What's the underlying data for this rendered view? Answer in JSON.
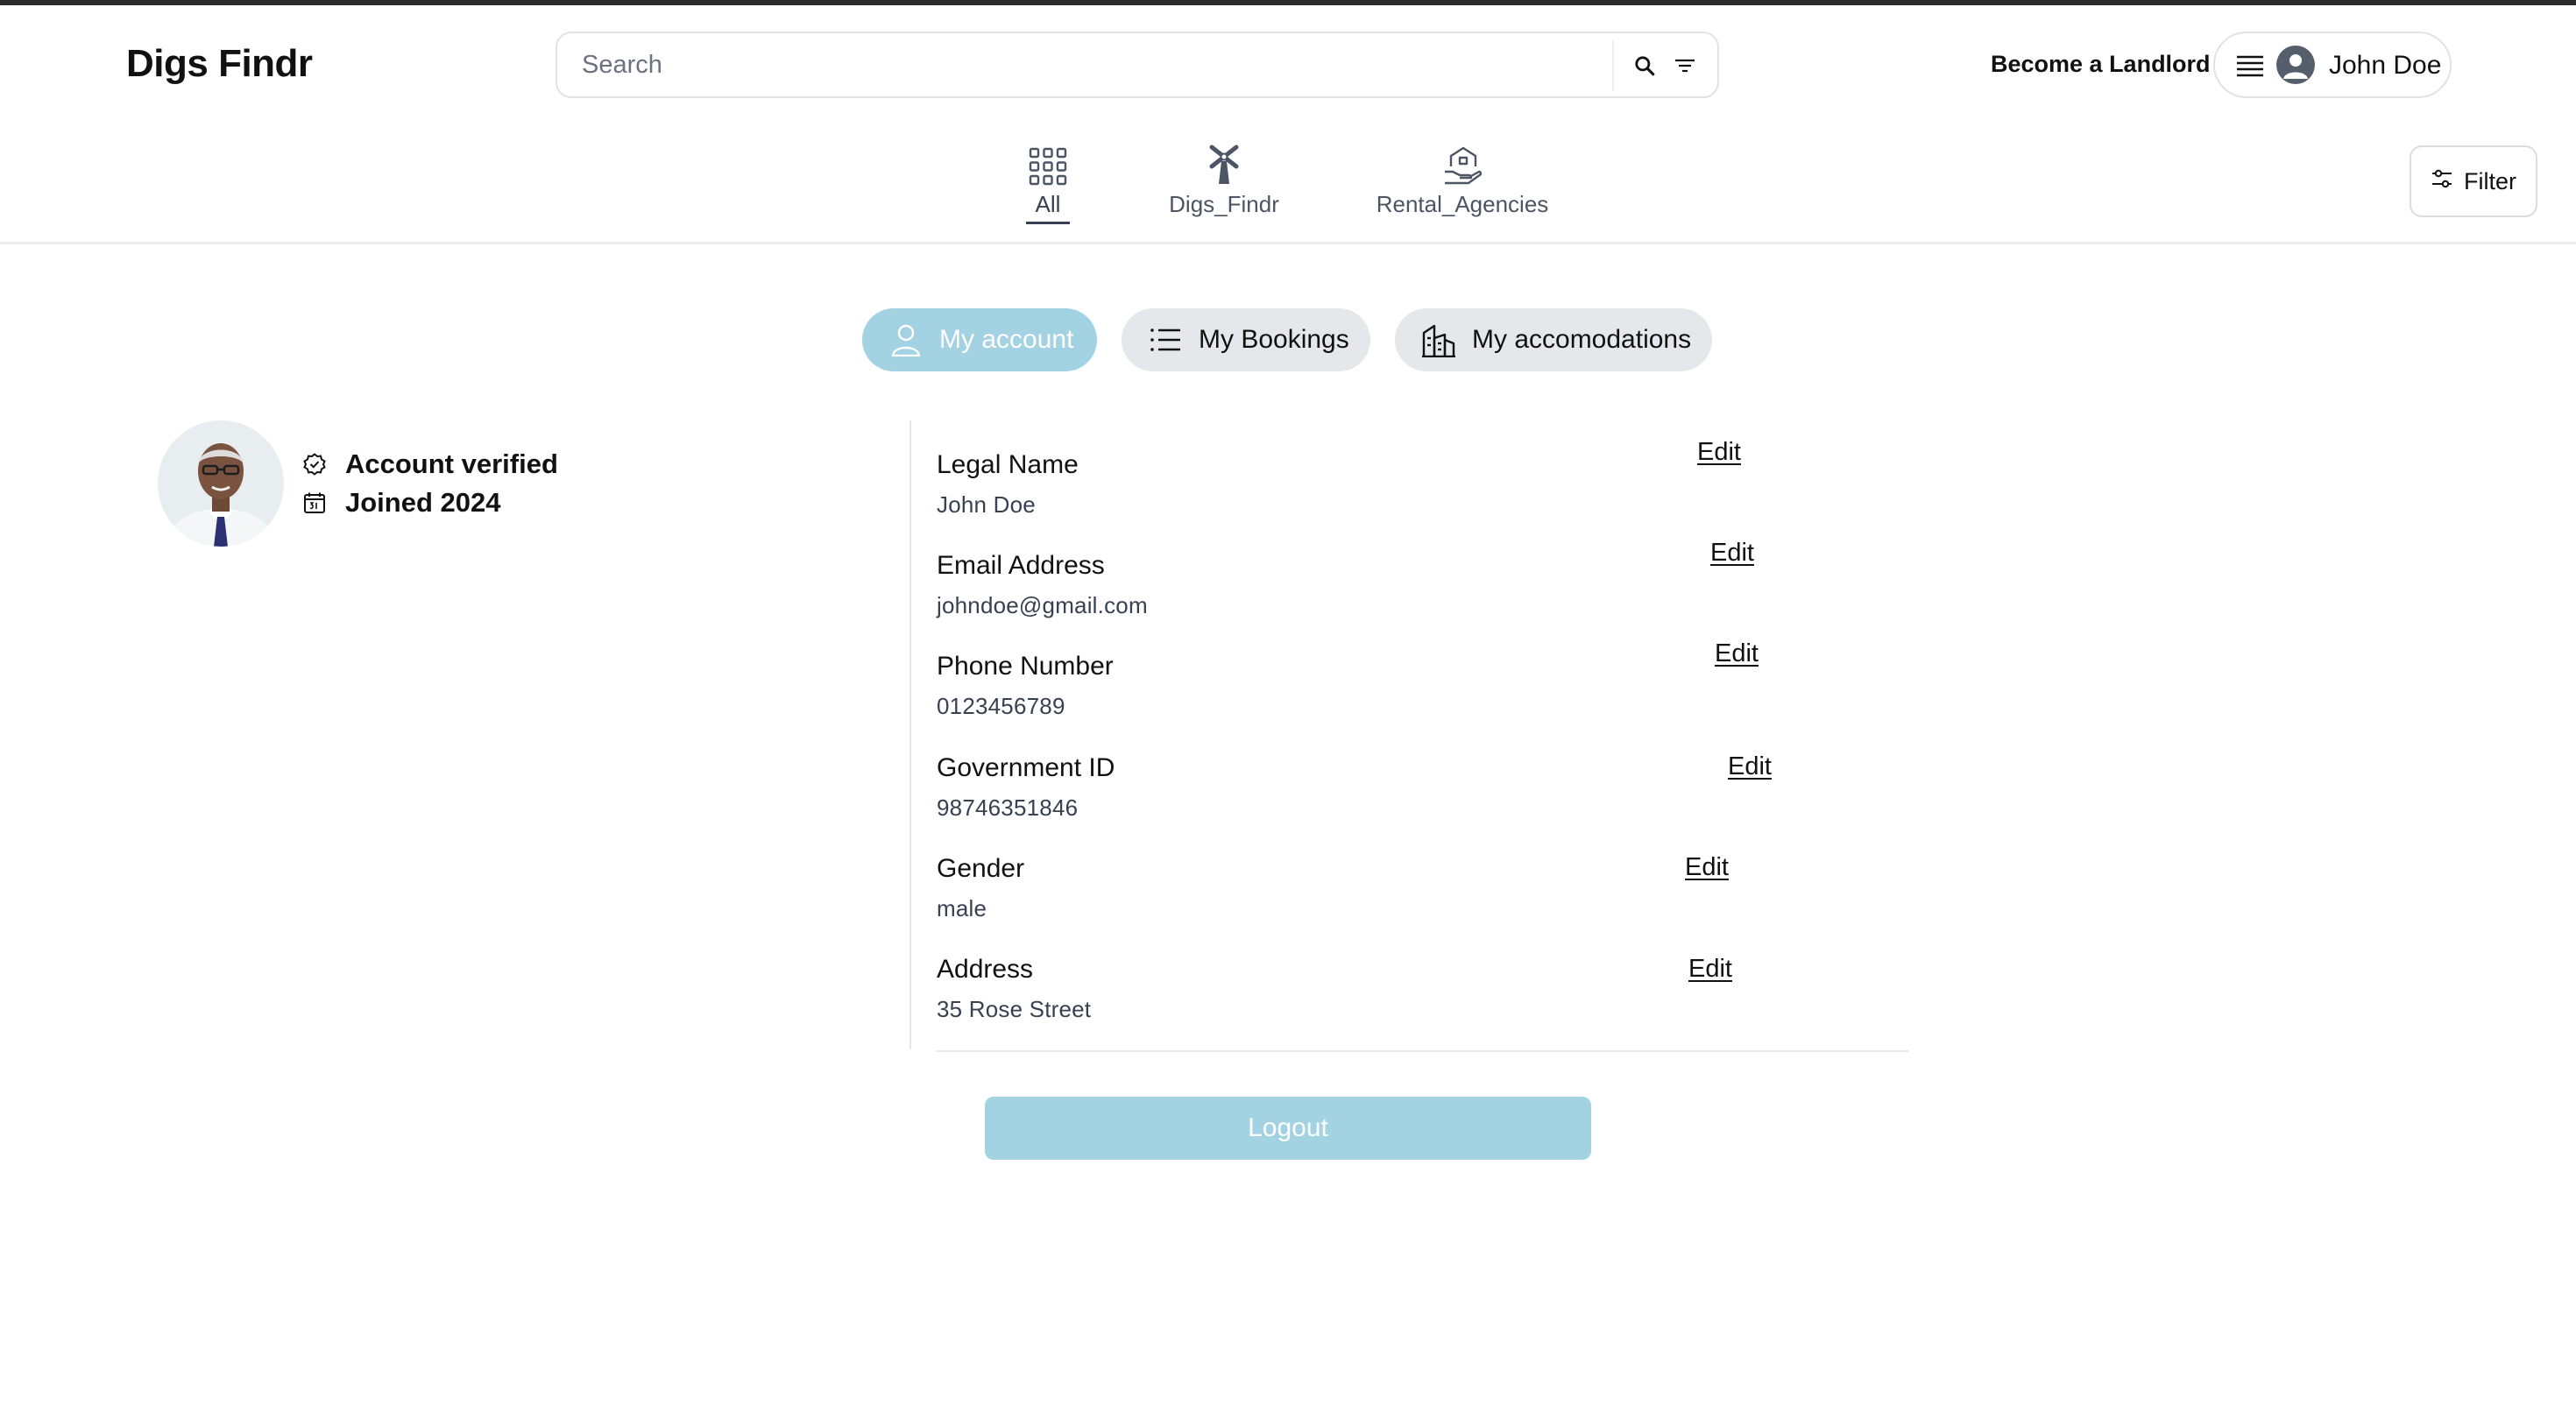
{
  "brand": {
    "name": "Digs Findr"
  },
  "search": {
    "placeholder": "Search",
    "value": ""
  },
  "header": {
    "become_landlord": "Become a Landlord",
    "user_name": "John Doe"
  },
  "categories": [
    {
      "label": "All",
      "icon": "grid-icon",
      "active": true
    },
    {
      "label": "Digs_Findr",
      "icon": "windmill-icon",
      "active": false
    },
    {
      "label": "Rental_Agencies",
      "icon": "house-hand-icon",
      "active": false
    }
  ],
  "filter": {
    "label": "Filter"
  },
  "tabs": [
    {
      "label": "My account",
      "icon": "user-icon",
      "active": true
    },
    {
      "label": "My Bookings",
      "icon": "list-icon",
      "active": false
    },
    {
      "label": "My accomodations",
      "icon": "building-icon",
      "active": false
    }
  ],
  "profile": {
    "verified": "Account verified",
    "joined": "Joined 2024"
  },
  "fields": [
    {
      "label": "Legal Name",
      "value": "John Doe",
      "action": "Edit"
    },
    {
      "label": "Email Address",
      "value": "johndoe@gmail.com",
      "action": "Edit"
    },
    {
      "label": "Phone Number",
      "value": "0123456789",
      "action": "Edit"
    },
    {
      "label": "Government ID",
      "value": "98746351846",
      "action": "Edit"
    },
    {
      "label": "Gender",
      "value": "male",
      "action": "Edit"
    },
    {
      "label": "Address",
      "value": "35 Rose Street",
      "action": "Edit"
    }
  ],
  "logout": {
    "label": "Logout"
  },
  "colors": {
    "accent": "#a3d2e3",
    "tab_inactive": "#e5e7eb",
    "text": "#111111"
  }
}
